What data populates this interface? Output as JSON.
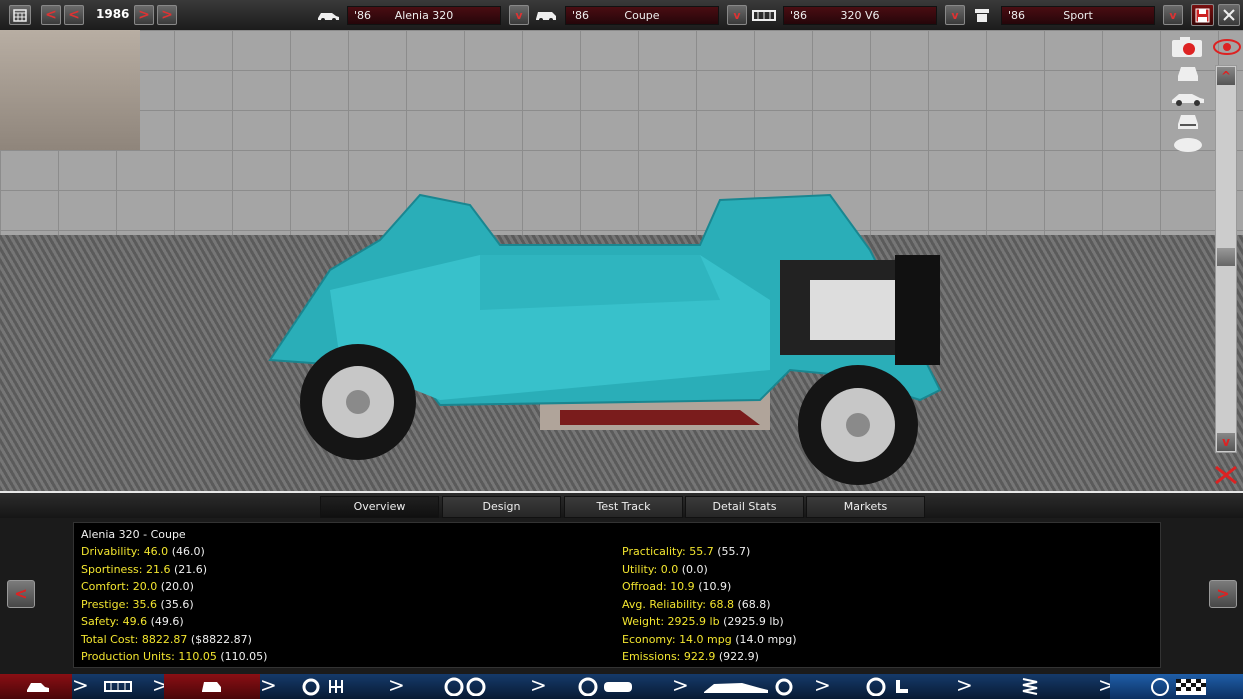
{
  "topbar": {
    "year": "1986",
    "selectors": [
      {
        "year": "'86",
        "name": "Alenia 320",
        "icon": "car-side-icon"
      },
      {
        "year": "'86",
        "name": "Coupe",
        "icon": "body-icon"
      },
      {
        "year": "'86",
        "name": "320 V6",
        "icon": "engine-icon"
      },
      {
        "year": "'86",
        "name": "Sport",
        "icon": "trim-icon"
      }
    ],
    "dropdown_arrow": "v",
    "prev_glyph": "<",
    "next_glyph": ">"
  },
  "scene": {
    "side_icons": [
      "camera-icon",
      "view-front-icon",
      "view-side-icon",
      "view-rear-icon",
      "view-top-icon"
    ],
    "scroll_up": "^",
    "scroll_down": "v"
  },
  "tabs": [
    {
      "label": "Overview",
      "active": true
    },
    {
      "label": "Design",
      "active": false
    },
    {
      "label": "Test Track",
      "active": false
    },
    {
      "label": "Detail Stats",
      "active": false
    },
    {
      "label": "Markets",
      "active": false
    }
  ],
  "panel": {
    "title": "Alenia 320 - Coupe",
    "left_stats": [
      {
        "label": "Drivability:",
        "value": "46.0",
        "paren": "(46.0)"
      },
      {
        "label": "Sportiness:",
        "value": "21.6",
        "paren": "(21.6)"
      },
      {
        "label": "Comfort:",
        "value": "20.0",
        "paren": "(20.0)"
      },
      {
        "label": "Prestige:",
        "value": "35.6",
        "paren": "(35.6)"
      },
      {
        "label": "Safety:",
        "value": "49.6",
        "paren": "(49.6)"
      },
      {
        "label": "Total Cost:",
        "value": "8822.87",
        "paren": "($8822.87)"
      },
      {
        "label": "Production Units:",
        "value": "110.05",
        "paren": "(110.05)"
      }
    ],
    "right_stats": [
      {
        "label": "Practicality:",
        "value": "55.7",
        "paren": "(55.7)"
      },
      {
        "label": "Utility:",
        "value": "0.0",
        "paren": "(0.0)"
      },
      {
        "label": "Offroad:",
        "value": "10.9",
        "paren": "(10.9)"
      },
      {
        "label": "Avg. Reliability:",
        "value": "68.8",
        "paren": "(68.8)"
      },
      {
        "label": "Weight:",
        "value": "2925.9 lb",
        "paren": "(2925.9 lb)"
      },
      {
        "label": "Economy:",
        "value": "14.0 mpg",
        "paren": "(14.0 mpg)"
      },
      {
        "label": "Emissions:",
        "value": "922.9",
        "paren": "(922.9)"
      }
    ],
    "prev_glyph": "<",
    "next_glyph": ">"
  },
  "bottom_nav": {
    "segments": [
      "car-overview-icon",
      "chassis-icon",
      "body-design-icon",
      "engine-gearbox-icon",
      "wheels-icon",
      "brakes-icon",
      "aero-cooling-icon",
      "interior-icon",
      "suspension-icon",
      "testing-icon"
    ],
    "chevron": ">"
  },
  "colors": {
    "accent_red": "#d22222",
    "stat_yellow": "#f2e52f",
    "nav_blue": "#153a6a",
    "car_teal": "#2aaeb8"
  }
}
